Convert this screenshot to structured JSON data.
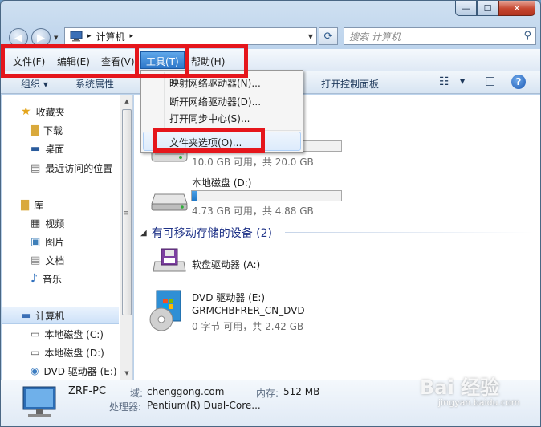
{
  "window": {
    "min_glyph": "—",
    "max_glyph": "☐",
    "close_glyph": "✕"
  },
  "address": {
    "path_root_arrow": "▸",
    "location": "计算机",
    "path_arrow": "▸"
  },
  "search": {
    "placeholder": "搜索 计算机"
  },
  "menubar": {
    "items": [
      "文件(F)",
      "编辑(E)",
      "查看(V)",
      "工具(T)",
      "帮助(H)"
    ],
    "active_index": 3
  },
  "toolbar": {
    "organize": "组织 ▾",
    "system_properties": "系统属性",
    "open_control_panel": "打开控制面板"
  },
  "tools_menu": {
    "items": [
      "映射网络驱动器(N)...",
      "断开网络驱动器(D)...",
      "打开同步中心(S)...",
      "文件夹选项(O)..."
    ]
  },
  "navpane": {
    "favorites": "收藏夹",
    "downloads": "下载",
    "desktop": "桌面",
    "recent": "最近访问的位置",
    "libraries": "库",
    "videos": "视频",
    "pictures": "图片",
    "documents": "文档",
    "music": "音乐",
    "computer": "计算机",
    "drive_c": "本地磁盘 (C:)",
    "drive_d": "本地磁盘 (D:)",
    "drive_e": "DVD 驱动器 (E:)"
  },
  "content": {
    "drive_c_space": "10.0 GB 可用，共 20.0 GB",
    "drive_c_fill": 0.5,
    "drive_d_name": "本地磁盘 (D:)",
    "drive_d_space": "4.73 GB 可用，共 4.88 GB",
    "drive_d_fill": 0.03,
    "removable_group": "有可移动存储的设备 (2)",
    "floppy_name": "软盘驱动器 (A:)",
    "dvd_name": "DVD 驱动器 (E:)",
    "dvd_label": "GRMCHBFRER_CN_DVD",
    "dvd_space": "0 字节 可用，共 2.42 GB"
  },
  "details": {
    "pc_name": "ZRF-PC",
    "domain_label": "域:",
    "domain_value": "chenggong.com",
    "memory_label": "内存:",
    "memory_value": "512 MB",
    "cpu_label": "处理器:",
    "cpu_value": "Pentium(R) Dual-Core..."
  },
  "watermark": {
    "logo": "Bai 经验",
    "url": "jingyan.baidu.com"
  }
}
